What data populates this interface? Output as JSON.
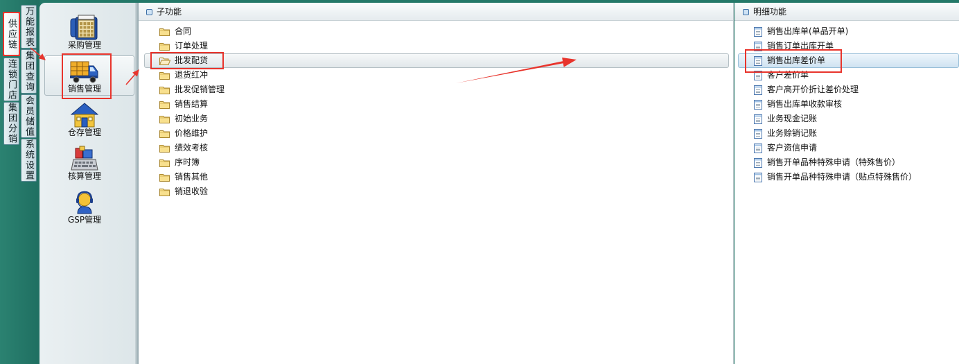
{
  "nav_tabs": {
    "primary": [
      {
        "label": "供应链",
        "selected": true
      },
      {
        "label": "连锁门店",
        "selected": false
      },
      {
        "label": "集团分销",
        "selected": false
      }
    ],
    "secondary": [
      {
        "label": "万能报表"
      },
      {
        "label": "集团查询"
      },
      {
        "label": "会员储值"
      },
      {
        "label": "系统设置"
      }
    ]
  },
  "modules": [
    {
      "label": "采购管理",
      "icon": "purchase-phone-icon",
      "selected": false
    },
    {
      "label": "销售管理",
      "icon": "delivery-truck-icon",
      "selected": true
    },
    {
      "label": "仓存管理",
      "icon": "warehouse-house-icon",
      "selected": false
    },
    {
      "label": "核算管理",
      "icon": "accounting-computer-icon",
      "selected": false
    },
    {
      "label": "GSP管理",
      "icon": "headset-person-icon",
      "selected": false
    }
  ],
  "sub_functions": {
    "title": "子功能",
    "header_icon": "square-bullet-icon",
    "item_icon": "folder-icon",
    "items": [
      {
        "label": "合同"
      },
      {
        "label": "订单处理"
      },
      {
        "label": "批发配货",
        "selected": true
      },
      {
        "label": "退货红冲"
      },
      {
        "label": "批发促销管理"
      },
      {
        "label": "销售结算"
      },
      {
        "label": "初始业务"
      },
      {
        "label": "价格维护"
      },
      {
        "label": "绩效考核"
      },
      {
        "label": "序时簿"
      },
      {
        "label": "销售其他"
      },
      {
        "label": "销退收验"
      }
    ]
  },
  "detail_functions": {
    "title": "明细功能",
    "header_icon": "square-bullet-icon",
    "item_icon": "document-icon",
    "items": [
      {
        "label": "销售出库单(单品开单)"
      },
      {
        "label": "销售订单出库开单"
      },
      {
        "label": "销售出库差价单",
        "selected": true
      },
      {
        "label": "客户差价单"
      },
      {
        "label": "客户高开价折让差价处理"
      },
      {
        "label": "销售出库单收款审核"
      },
      {
        "label": "业务现金记账"
      },
      {
        "label": "业务赊销记账"
      },
      {
        "label": "客户资信申请"
      },
      {
        "label": "销售开单品种特殊申请（特殊售价）"
      },
      {
        "label": "销售开单品种特殊申请（贴点特殊售价）"
      }
    ]
  },
  "colors": {
    "nav_background": "#237868",
    "annotation_red": "#e8342c",
    "detail_selection": "#cfe3f1",
    "sub_selection": "#e1e7ea"
  }
}
